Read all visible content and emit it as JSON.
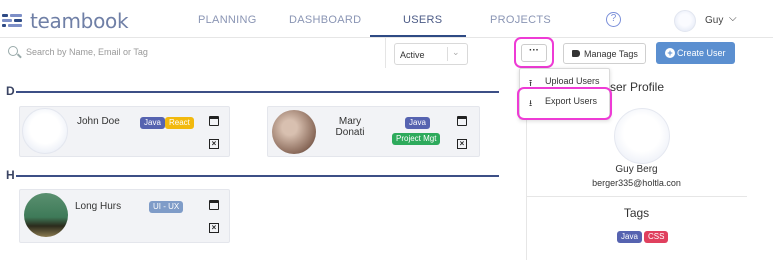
{
  "app": {
    "logo_text": "teambook"
  },
  "nav": {
    "items": [
      {
        "label": "PLANNING"
      },
      {
        "label": "DASHBOARD"
      },
      {
        "label": "USERS"
      },
      {
        "label": "PROJECTS"
      }
    ],
    "help_icon": "?",
    "user_name": "Guy",
    "chevron": "⌄"
  },
  "toolbar": {
    "search_placeholder": "Search by Name, Email or Tag",
    "status_value": "Active",
    "more_label": "···",
    "manage_tags_label": "Manage Tags",
    "create_user_label": "Create User",
    "create_icon": "+"
  },
  "menu": {
    "items": [
      {
        "label": "Upload Users",
        "icon": "upload-icon",
        "glyph": "⭱"
      },
      {
        "label": "Export Users",
        "icon": "download-icon",
        "glyph": "⭳"
      }
    ]
  },
  "groups": [
    {
      "letter": "D",
      "users": [
        {
          "name": "John Doe",
          "tags": [
            {
              "label": "Java",
              "color": "#5663b0"
            },
            {
              "label": "React",
              "color": "#f2b90e"
            }
          ]
        },
        {
          "name": "Mary Donati",
          "name_line1": "Mary",
          "name_line2": "Donati",
          "tags": [
            {
              "label": "Java",
              "color": "#5663b0"
            },
            {
              "label": "Project Mgt",
              "color": "#2eaa5c"
            }
          ]
        }
      ]
    },
    {
      "letter": "H",
      "users": [
        {
          "name": "Long Hurs",
          "tags": [
            {
              "label": "UI - UX",
              "color": "#7f9cc8"
            }
          ]
        }
      ]
    }
  ],
  "profile_panel": {
    "title": "User Profile",
    "title_visible": "ser Profile",
    "name": "Guy Berg",
    "email": "berger335@holtla.con",
    "tags_title": "Tags",
    "tags": [
      {
        "label": "Java",
        "color": "#5663b0"
      },
      {
        "label": "CSS",
        "color": "#e0405e"
      }
    ]
  },
  "colors": {
    "accent": "#2e4a84",
    "primary_button": "#5b8fd0",
    "highlight": "#ee3bd5"
  }
}
